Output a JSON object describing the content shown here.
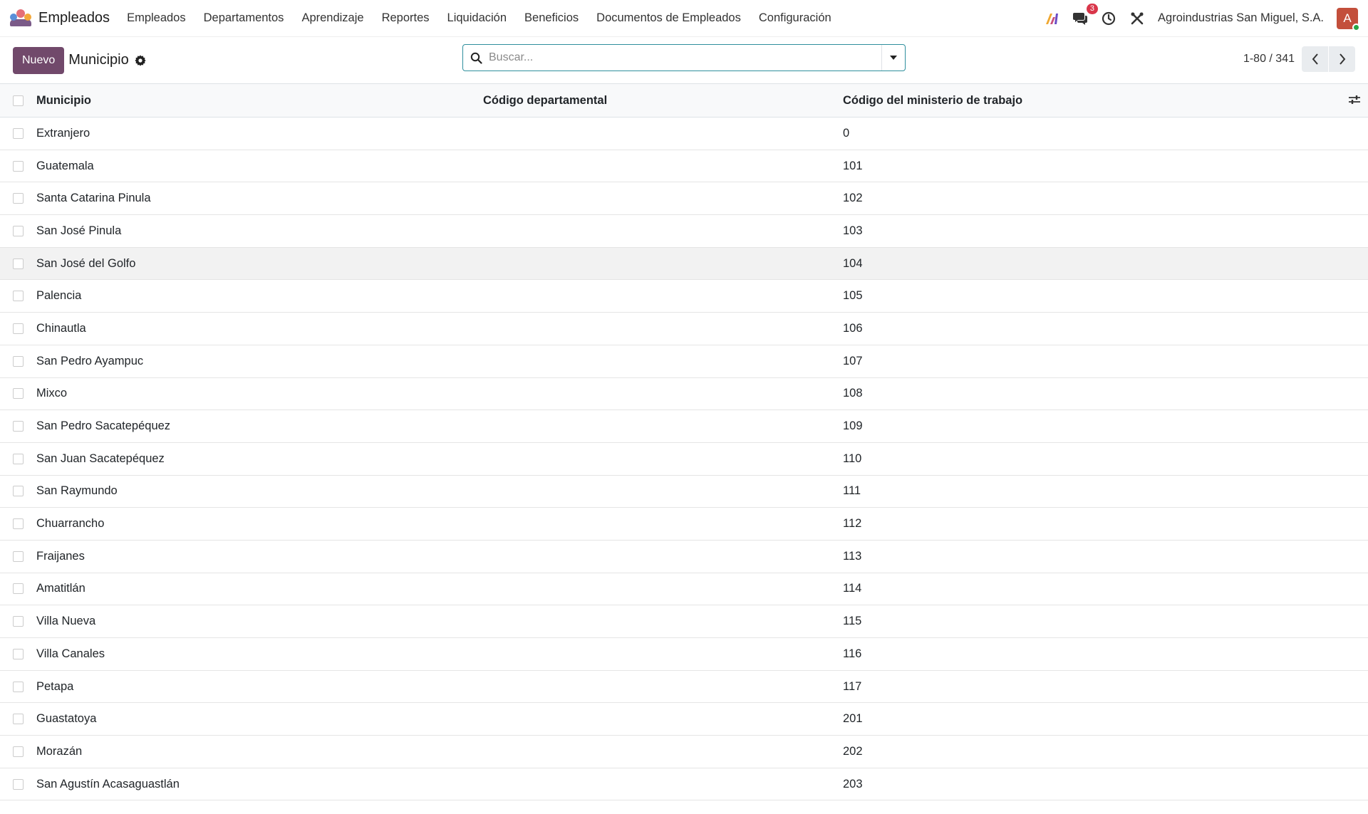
{
  "navbar": {
    "app_name": "Empleados",
    "menu": [
      "Empleados",
      "Departamentos",
      "Aprendizaje",
      "Reportes",
      "Liquidación",
      "Beneficios",
      "Documentos de Empleados",
      "Configuración"
    ],
    "messages_count": "3",
    "company": "Agroindustrias San Miguel, S.A.",
    "avatar_letter": "A"
  },
  "control": {
    "new_label": "Nuevo",
    "title": "Municipio",
    "search_placeholder": "Buscar...",
    "pager": "1-80 / 341"
  },
  "table": {
    "headers": [
      "Municipio",
      "Código departamental",
      "Código del ministerio de trabajo"
    ],
    "rows": [
      {
        "municipio": "Extranjero",
        "dep": "",
        "min": "0"
      },
      {
        "municipio": "Guatemala",
        "dep": "",
        "min": "101"
      },
      {
        "municipio": "Santa Catarina Pinula",
        "dep": "",
        "min": "102"
      },
      {
        "municipio": "San José Pinula",
        "dep": "",
        "min": "103"
      },
      {
        "municipio": "San José del Golfo",
        "dep": "",
        "min": "104"
      },
      {
        "municipio": "Palencia",
        "dep": "",
        "min": "105"
      },
      {
        "municipio": "Chinautla",
        "dep": "",
        "min": "106"
      },
      {
        "municipio": "San Pedro Ayampuc",
        "dep": "",
        "min": "107"
      },
      {
        "municipio": "Mixco",
        "dep": "",
        "min": "108"
      },
      {
        "municipio": "San Pedro Sacatepéquez",
        "dep": "",
        "min": "109"
      },
      {
        "municipio": "San Juan Sacatepéquez",
        "dep": "",
        "min": "110"
      },
      {
        "municipio": "San Raymundo",
        "dep": "",
        "min": "111"
      },
      {
        "municipio": "Chuarrancho",
        "dep": "",
        "min": "112"
      },
      {
        "municipio": "Fraijanes",
        "dep": "",
        "min": "113"
      },
      {
        "municipio": "Amatitlán",
        "dep": "",
        "min": "114"
      },
      {
        "municipio": "Villa Nueva",
        "dep": "",
        "min": "115"
      },
      {
        "municipio": "Villa Canales",
        "dep": "",
        "min": "116"
      },
      {
        "municipio": "Petapa",
        "dep": "",
        "min": "117"
      },
      {
        "municipio": "Guastatoya",
        "dep": "",
        "min": "201"
      },
      {
        "municipio": "Morazán",
        "dep": "",
        "min": "202"
      },
      {
        "municipio": "San Agustín Acasaguastlán",
        "dep": "",
        "min": "203"
      }
    ]
  },
  "colors": {
    "primary": "#71496b",
    "search_border": "#2f8f9d",
    "badge": "#d9364a",
    "avatar": "#c34f3b"
  }
}
